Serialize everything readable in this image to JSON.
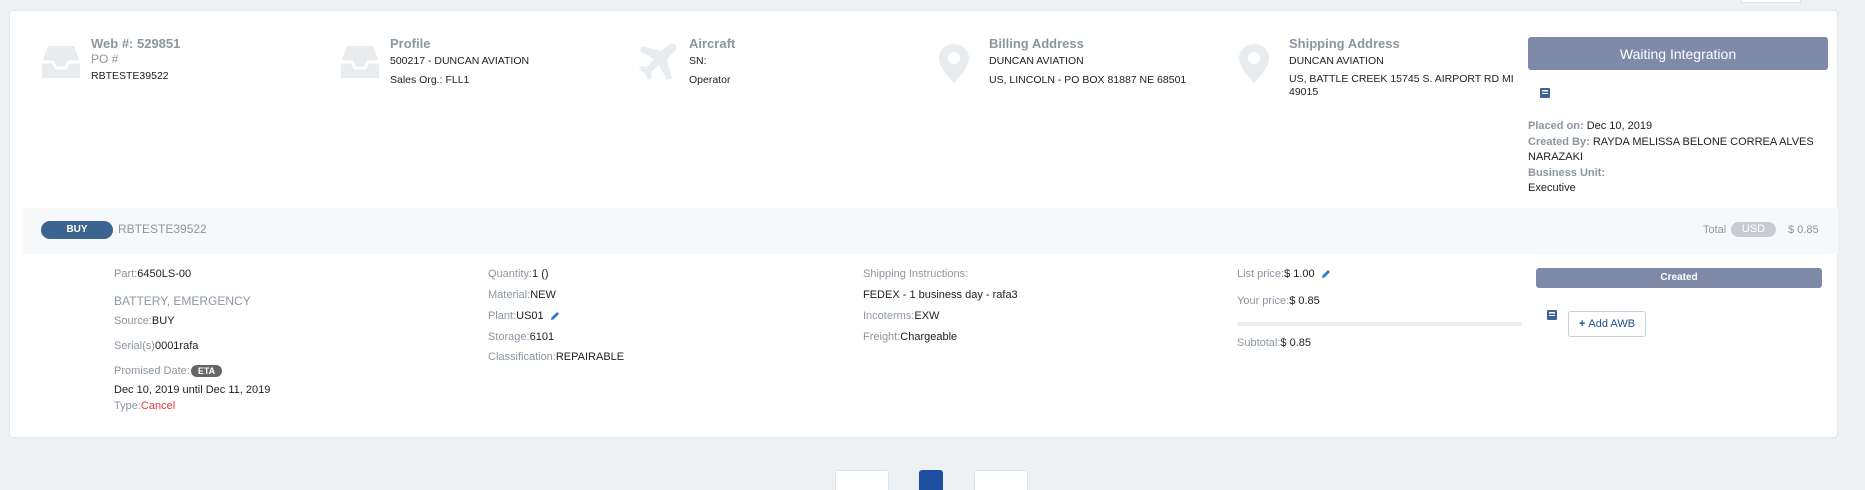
{
  "header": {
    "web": {
      "title": "Web #: 529851",
      "subtitle": "PO #",
      "line1": "RBTESTE39522"
    },
    "profile": {
      "title": "Profile",
      "line1": "500217 - DUNCAN AVIATION",
      "line2": "Sales Org.: FLL1"
    },
    "aircraft": {
      "title": "Aircraft",
      "line1": "SN:",
      "line2": "Operator"
    },
    "billing": {
      "title": "Billing Address",
      "line1": "DUNCAN AVIATION",
      "line2": "US, LINCOLN - PO BOX 81887 NE 68501"
    },
    "shipping": {
      "title": "Shipping Address",
      "line1": "DUNCAN AVIATION",
      "line2": "US, BATTLE CREEK 15745 S. AIRPORT RD MI 49015"
    }
  },
  "status": {
    "label": "Waiting Integration",
    "placed_on_label": "Placed on:",
    "placed_on": "Dec 10, 2019",
    "created_by_label": "Created By:",
    "created_by": "RAYDA MELISSA BELONE CORREA ALVES NARAZAKI",
    "business_unit_label": "Business Unit:",
    "business_unit": "Executive"
  },
  "order": {
    "type_badge": "BUY",
    "number": "RBTESTE39522",
    "total_label": "Total",
    "currency": "USD",
    "total": "$ 0.85"
  },
  "item": {
    "part_label": "Part:",
    "part": "6450LS-00",
    "description": "BATTERY, EMERGENCY",
    "source_label": "Source:",
    "source": "BUY",
    "serial_label": "Serial(s)",
    "serial": "0001rafa",
    "promised_label": "Promised Date:",
    "eta_badge": "ETA",
    "promised_range": "Dec 10, 2019 until Dec 11, 2019",
    "type_label": "Type:",
    "type": "Cancel",
    "quantity_label": "Quantity:",
    "quantity": "1 ()",
    "material_label": "Material:",
    "material": "NEW",
    "plant_label": "Plant:",
    "plant": "US01",
    "storage_label": "Storage:",
    "storage": "6101",
    "classification_label": "Classification:",
    "classification": "REPAIRABLE",
    "shipping_instr_label": "Shipping Instructions:",
    "shipping_instr": "FEDEX - 1 business day - rafa3",
    "incoterms_label": "Incoterms:",
    "incoterms": "EXW",
    "freight_label": "Freight:",
    "freight": "Chargeable",
    "list_price_label": "List price:",
    "list_price": "$ 1.00",
    "your_price_label": "Your price:",
    "your_price": "$ 0.85",
    "subtotal_label": "Subtotal:",
    "subtotal": "$ 0.85",
    "status": "Created",
    "add_awb": "Add AWB"
  },
  "colors": {
    "accent": "#3c6490",
    "status": "#7e8aa7",
    "cancel": "#e53935",
    "pager_active": "#1d4fa0"
  },
  "icons": {
    "web": "inbox-icon",
    "profile": "inbox-icon",
    "aircraft": "airplane-icon",
    "billing": "map-pin-icon",
    "shipping": "map-pin-icon",
    "book": "book-icon",
    "edit": "pencil-icon"
  }
}
